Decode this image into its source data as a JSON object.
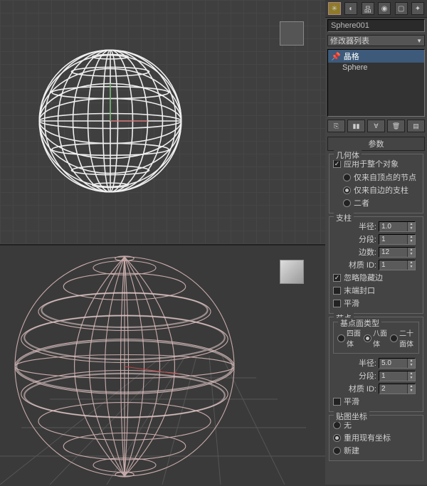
{
  "object_name": "Sphere001",
  "modifier_list_label": "修改器列表",
  "stack": {
    "mod": "晶格",
    "base": "Sphere"
  },
  "rollup_params": "参数",
  "group_geometry": "几何体",
  "geom": {
    "apply_whole": "应用于整个对象",
    "from_vertex": "仅来自顶点的节点",
    "from_edge": "仅来自边的支柱",
    "both": "二者"
  },
  "group_struts": "支柱",
  "struts": {
    "radius_label": "半径:",
    "radius_val": "1.0",
    "segments_label": "分段:",
    "segments_val": "1",
    "sides_label": "边数:",
    "sides_val": "12",
    "mat_label": "材质 ID:",
    "mat_val": "1",
    "hide_hidden": "忽略隐藏边",
    "cap_ends": "末端封口",
    "smooth": "平滑"
  },
  "group_joints": "节点",
  "base_type_label": "基点面类型",
  "base_types": {
    "tetra": "四面体",
    "octa": "八面体",
    "icosa": "二十面体"
  },
  "joints": {
    "radius_label": "半径:",
    "radius_val": "5.0",
    "segments_label": "分段:",
    "segments_val": "1",
    "mat_label": "材质 ID:",
    "mat_val": "2",
    "smooth": "平滑"
  },
  "group_mapping": "贴图坐标",
  "mapping": {
    "none": "无",
    "reuse": "重用现有坐标",
    "new": "新建"
  }
}
